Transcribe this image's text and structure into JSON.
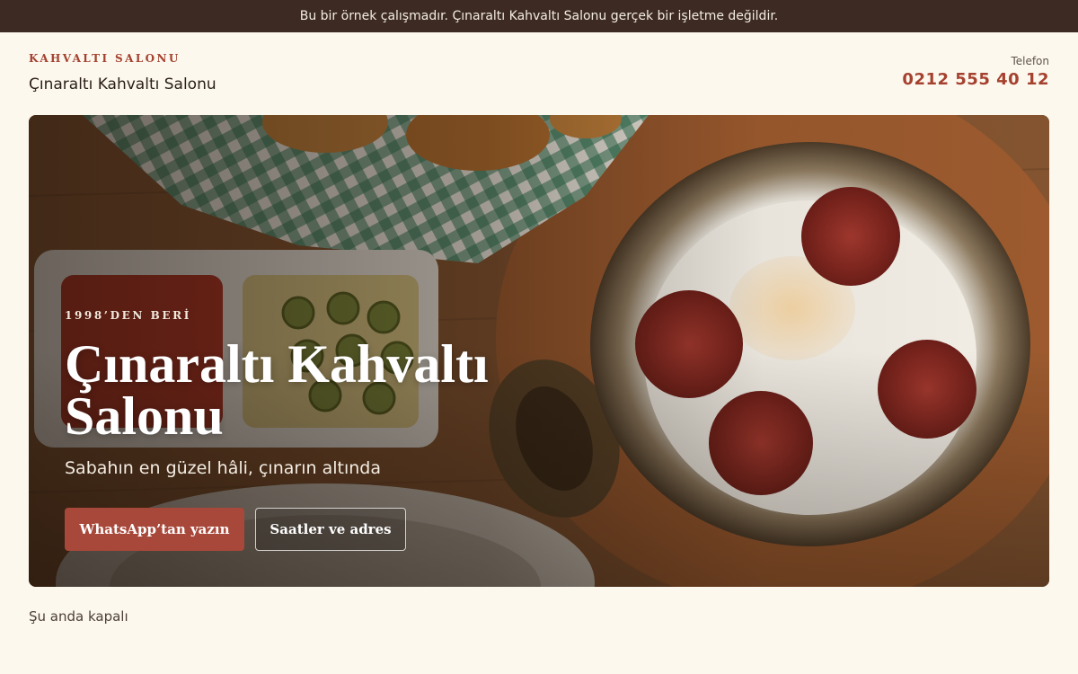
{
  "notice": {
    "text": "Bu bir örnek çalışmadır. Çınaraltı Kahvaltı Salonu gerçek bir işletme değildir."
  },
  "header": {
    "eyebrow": "KAHVALTI SALONU",
    "brand_name": "Çınaraltı Kahvaltı Salonu",
    "phone_label": "Telefon",
    "phone_number": "0212 555 40 12"
  },
  "hero": {
    "eyebrow": "1998’DEN BERİ",
    "title": "Çınaraltı Kahvaltı Salonu",
    "subtitle": "Sabahın en güzel hâli, çınarın altında",
    "primary_button": "WhatsApp’tan yazın",
    "secondary_button": "Saatler ve adres"
  },
  "status": {
    "text": "Şu anda kapalı"
  },
  "colors": {
    "banner_bg": "#3d2b23",
    "page_bg": "#fcf8ee",
    "accent": "#a5412f",
    "button_primary": "#a8483a"
  }
}
